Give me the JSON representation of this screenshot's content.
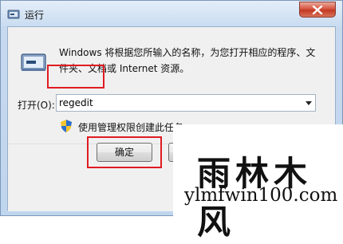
{
  "window": {
    "title": "运行",
    "close_label": "×"
  },
  "dialog": {
    "description": "Windows 将根据您所输入的名称，为您打开相应的程序、文件夹、文档或 Internet 资源。",
    "open_label": "打开(O):",
    "open_value": "regedit",
    "admin_text": "使用管理权限创建此任务。"
  },
  "buttons": {
    "ok_label": "确定"
  },
  "watermark": {
    "logo_text": "雨林木风",
    "url": "ylmfwin100.com"
  },
  "colors": {
    "highlight": "#e01b22",
    "title_bar": "#c9dcf1",
    "close_button": "#c23a23"
  }
}
